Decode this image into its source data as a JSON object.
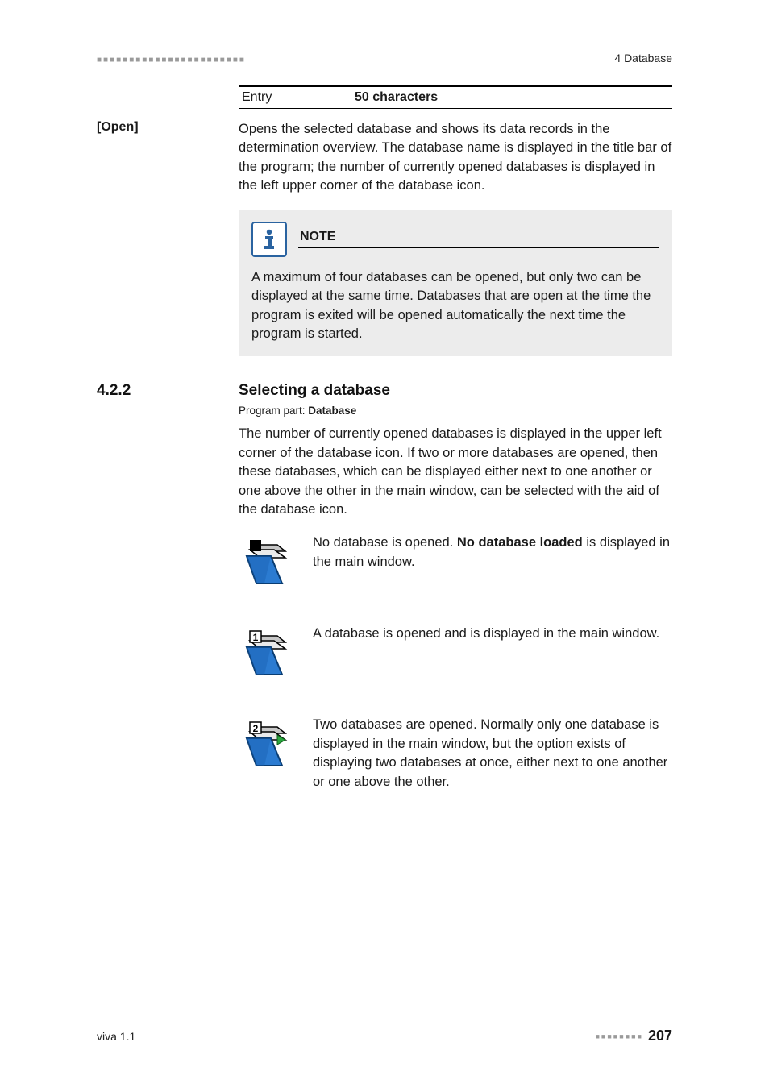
{
  "header": {
    "section_label": "4 Database"
  },
  "entry": {
    "label": "Entry",
    "value": "50 characters"
  },
  "open": {
    "label": "[Open]",
    "paragraph": "Opens the selected database and shows its data records in the determination overview. The database name is displayed in the title bar of the program; the number of currently opened databases is displayed in the left upper corner of the database icon."
  },
  "note": {
    "title": "NOTE",
    "body": "A maximum of four databases can be opened, but only two can be displayed at the same time. Databases that are open at the time the program is exited will be opened automatically the next time the program is started."
  },
  "section": {
    "number": "4.2.2",
    "title": "Selecting a database",
    "program_part_label": "Program part: ",
    "program_part_value": "Database",
    "intro": "The number of currently opened databases is displayed in the upper left corner of the database icon. If two or more databases are opened, then these databases, which can be displayed either next to one another or one above the other in the main window, can be selected with the aid of the database icon."
  },
  "icons": {
    "item0_pre": "No database is opened. ",
    "item0_bold": "No database loaded",
    "item0_post": " is displayed in the main window.",
    "item1": "A database is opened and is displayed in the main window.",
    "item2": "Two databases are opened. Normally only one database is displayed in the main window, but the option exists of displaying two databases at once, either next to one another or one above the other."
  },
  "footer": {
    "left": "viva 1.1",
    "page": "207"
  }
}
